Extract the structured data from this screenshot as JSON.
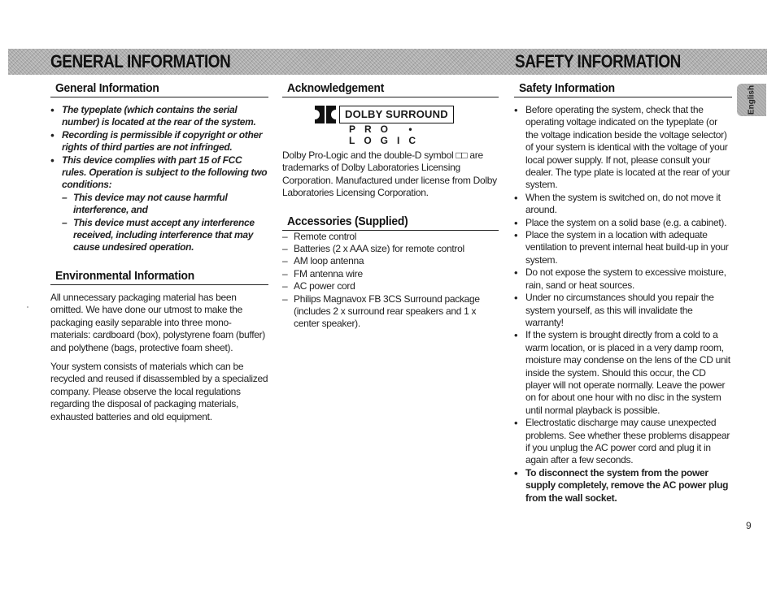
{
  "banners": {
    "left": "GENERAL INFORMATION",
    "right": "SAFETY INFORMATION"
  },
  "language_tab": "English",
  "page_number": "9",
  "general_information": {
    "heading": "General Information",
    "bullets": [
      "The typeplate (which contains the serial number) is located at the rear of the system.",
      "Recording is permissible if copyright or other rights of third parties are not infringed.",
      "This device complies with part 15 of FCC rules. Operation is subject to the following two conditions:"
    ],
    "conditions": [
      "This device may not cause harmful interference, and",
      "This device must accept any interference received, including interference that may cause undesired operation."
    ]
  },
  "environmental_information": {
    "heading": "Environmental Information",
    "paragraphs": [
      "All unnecessary packaging material has been omitted. We have done our utmost to make the packaging easily separable into three mono-materials: cardboard (box), polystyrene foam (buffer) and polythene (bags, protective foam sheet).",
      "Your system consists of materials which can be recycled and reused if disassembled by a specialized company. Please observe the local regulations regarding the disposal of packaging materials, exhausted batteries and old equipment."
    ]
  },
  "acknowledgement": {
    "heading": "Acknowledgement",
    "logo": {
      "box_text": "DOLBY SURROUND",
      "subtitle": "PRO • LOGIC"
    },
    "text": "Dolby Pro-Logic and the double-D symbol □□ are trademarks of Dolby Laboratories Licensing Corporation. Manufactured under license from Dolby Laboratories Licensing Corporation."
  },
  "accessories": {
    "heading": "Accessories (Supplied)",
    "items": [
      "Remote control",
      "Batteries (2 x AAA size) for remote control",
      "AM loop antenna",
      "FM antenna wire",
      "AC power cord",
      "Philips Magnavox FB 3CS Surround package (includes 2 x surround rear speakers and 1 x center speaker)."
    ]
  },
  "safety_information": {
    "heading": "Safety Information",
    "bullets": [
      "Before operating the system, check that the operating voltage indicated on the typeplate (or the voltage indication beside the voltage selector) of your system is identical with the voltage of your local power supply. If not, please consult your dealer. The type plate is located at the rear of your system.",
      "When the system is switched on, do not move it around.",
      "Place the system on a solid base (e.g. a cabinet).",
      "Place the system in a location with adequate ventilation to prevent internal heat build-up in your system.",
      "Do not expose the system to excessive moisture, rain, sand or heat sources.",
      "Under no circumstances should you repair the system yourself, as this will invalidate the warranty!",
      "If the system is brought directly from a cold to a warm location, or is placed in a very damp room, moisture may condense on the lens of the CD unit inside the system. Should this occur, the CD player will not operate normally. Leave the power on for about one hour with no disc in the system until normal playback is possible.",
      "Electrostatic discharge may cause unexpected problems. See whether these problems disappear if you unplug the AC power cord and plug it in again after a few seconds."
    ],
    "bold_bullet": "To disconnect the system from the power supply completely, remove the AC power plug from the wall socket."
  }
}
